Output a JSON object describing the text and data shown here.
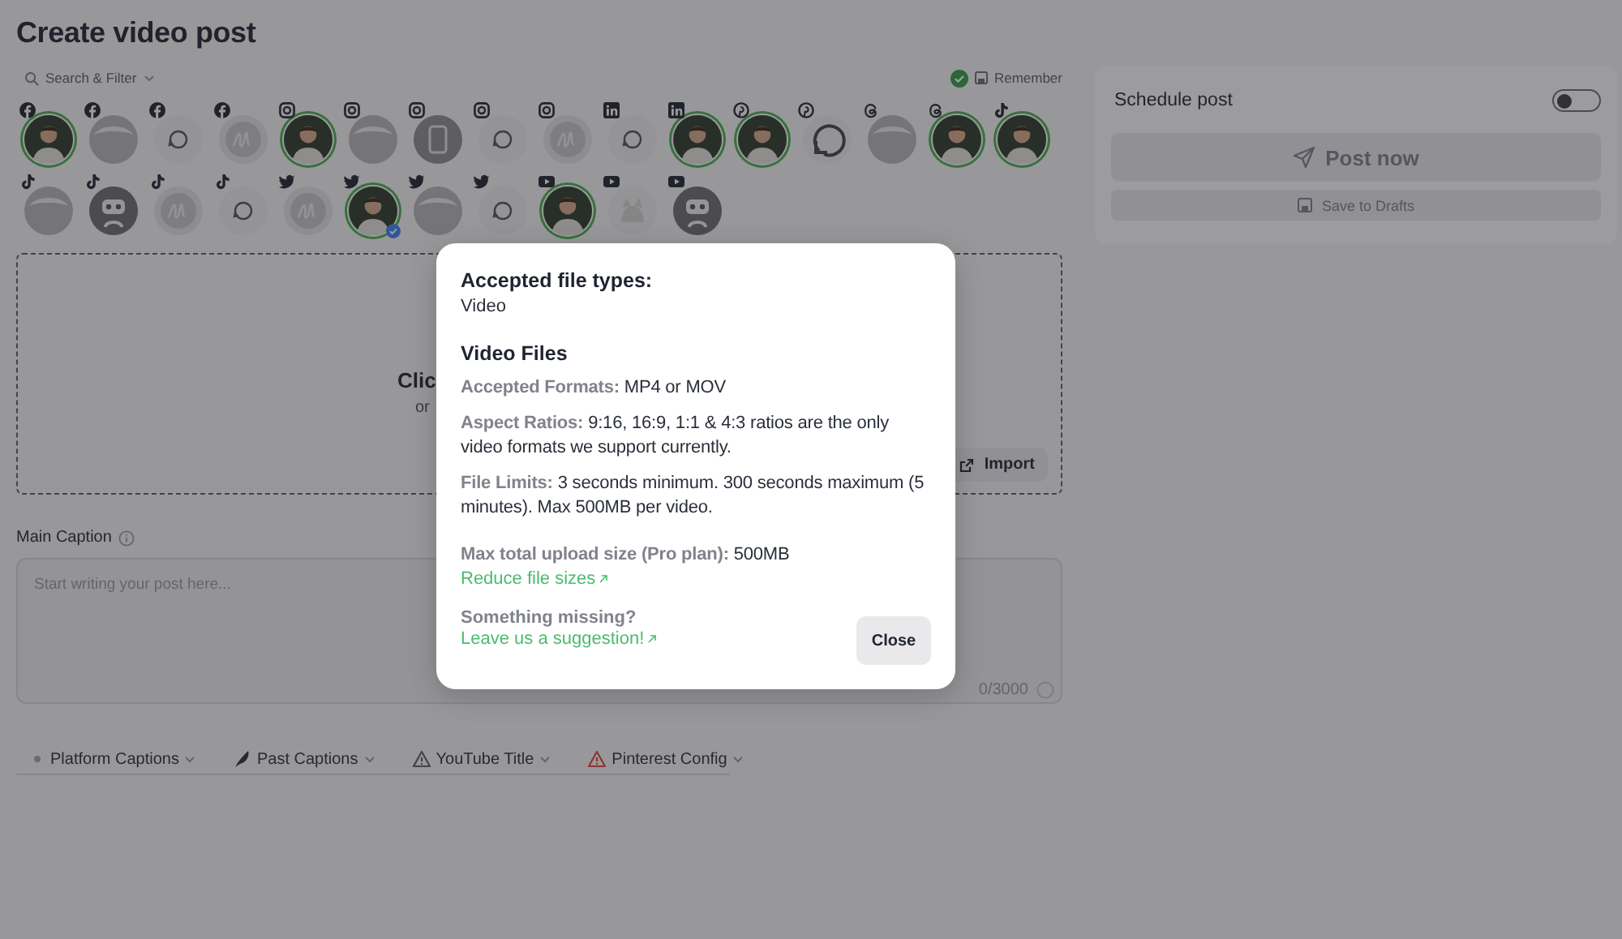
{
  "page": {
    "title": "Create video post",
    "search_filter": "Search & Filter",
    "remember": {
      "label": "Remember",
      "checked": true
    }
  },
  "accounts": [
    {
      "badge": {
        "kind": "facebook"
      },
      "picture": {
        "kind": "photo"
      },
      "selected": true
    },
    {
      "badge": {
        "kind": "facebook"
      },
      "picture": {
        "kind": "blank"
      },
      "selected": false
    },
    {
      "badge": {
        "kind": "facebook"
      },
      "picture": {
        "kind": "refresh"
      },
      "selected": false
    },
    {
      "badge": {
        "kind": "facebook"
      },
      "picture": {
        "kind": "scribble"
      },
      "selected": false
    },
    {
      "badge": {
        "kind": "instagram"
      },
      "picture": {
        "kind": "photo"
      },
      "selected": true
    },
    {
      "badge": {
        "kind": "instagram"
      },
      "picture": {
        "kind": "blank"
      },
      "selected": false
    },
    {
      "badge": {
        "kind": "instagram"
      },
      "picture": {
        "kind": "phone"
      },
      "selected": false
    },
    {
      "badge": {
        "kind": "instagram"
      },
      "picture": {
        "kind": "refresh"
      },
      "selected": false
    },
    {
      "badge": {
        "kind": "instagram"
      },
      "picture": {
        "kind": "scribble"
      },
      "selected": false
    },
    {
      "badge": {
        "kind": "linkedin"
      },
      "picture": {
        "kind": "refresh"
      },
      "selected": false
    },
    {
      "badge": {
        "kind": "linkedin"
      },
      "picture": {
        "kind": "photo"
      },
      "selected": true
    },
    {
      "badge": {
        "kind": "pinterest"
      },
      "picture": {
        "kind": "photo"
      },
      "selected": true
    },
    {
      "badge": {
        "kind": "pinterest"
      },
      "picture": {
        "kind": "bigrefresh"
      },
      "selected": false
    },
    {
      "badge": {
        "kind": "threads"
      },
      "picture": {
        "kind": "blank"
      },
      "selected": false
    },
    {
      "badge": {
        "kind": "threads"
      },
      "picture": {
        "kind": "photo"
      },
      "selected": true
    },
    {
      "badge": {
        "kind": "tiktok"
      },
      "picture": {
        "kind": "photo"
      },
      "selected": true
    },
    {
      "badge": {
        "kind": "tiktok"
      },
      "picture": {
        "kind": "blank"
      },
      "selected": false
    },
    {
      "badge": {
        "kind": "tiktok"
      },
      "picture": {
        "kind": "robot"
      },
      "selected": false
    },
    {
      "badge": {
        "kind": "tiktok"
      },
      "picture": {
        "kind": "scribble"
      },
      "selected": false
    },
    {
      "badge": {
        "kind": "tiktok"
      },
      "picture": {
        "kind": "refresh"
      },
      "selected": false
    },
    {
      "badge": {
        "kind": "twitter"
      },
      "picture": {
        "kind": "scribble"
      },
      "selected": false
    },
    {
      "badge": {
        "kind": "twitter"
      },
      "picture": {
        "kind": "photo"
      },
      "selected": true,
      "verified": true
    },
    {
      "badge": {
        "kind": "twitter"
      },
      "picture": {
        "kind": "blank"
      },
      "selected": false
    },
    {
      "badge": {
        "kind": "twitter"
      },
      "picture": {
        "kind": "refresh"
      },
      "selected": false
    },
    {
      "badge": {
        "kind": "youtube"
      },
      "picture": {
        "kind": "photo"
      },
      "selected": true
    },
    {
      "badge": {
        "kind": "youtube"
      },
      "picture": {
        "kind": "cat"
      },
      "selected": false
    },
    {
      "badge": {
        "kind": "youtube"
      },
      "picture": {
        "kind": "robot"
      },
      "selected": false
    }
  ],
  "upload": {
    "prompt": "Clic",
    "hint": "or",
    "import_button": "Import"
  },
  "caption": {
    "label": "Main Caption",
    "placeholder": "Start writing your post here...",
    "counter": "0/3000"
  },
  "caption_tabs": [
    {
      "label": "Platform Captions",
      "kind": "dot"
    },
    {
      "label": "Past Captions",
      "kind": "feather"
    },
    {
      "label": "YouTube Title",
      "kind": "warning"
    },
    {
      "label": "Pinterest Config",
      "kind": "error"
    }
  ],
  "schedule": {
    "label": "Schedule post",
    "on": false,
    "post_button": {
      "label": "Post now",
      "disabled": true
    },
    "drafts_button": {
      "label": "Save to Drafts",
      "disabled": true
    }
  },
  "modal": {
    "heading": "Accepted file types:",
    "types": "Video",
    "section_title": "Video Files",
    "details": [
      "**Accepted Formats:** MP4 or MOV",
      "**Aspect Ratios:** 9:16, 16:9, 1:1 & 4:3 ratios are the only video formats we support currently.",
      "**File Limits:** 3 seconds minimum. 300 seconds maximum (5 minutes). Max 500MB per video."
    ],
    "upload_limit": "**Max total upload size (Pro plan):** 500MB",
    "reduce_link": "Reduce file sizes",
    "missing_label": "Something missing?",
    "suggestion_link": "Leave us a suggestion!",
    "close_button": "Close"
  }
}
